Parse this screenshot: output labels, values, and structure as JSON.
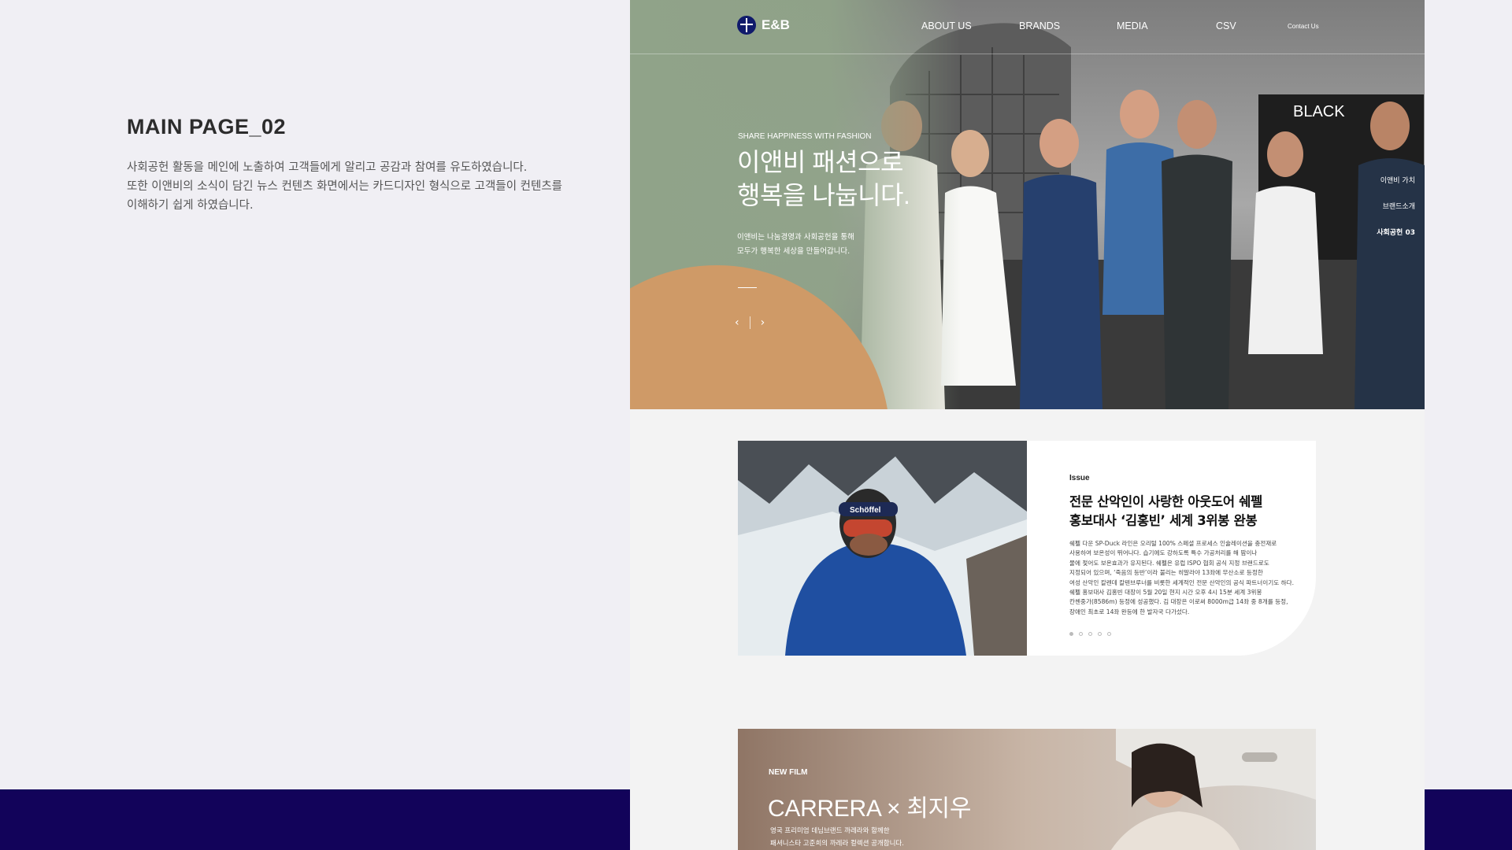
{
  "description": {
    "title": "MAIN PAGE_02",
    "lines": [
      "사회공헌 활동을 메인에 노출하여 고객들에게 알리고 공감과 참여를 유도하였습니다.",
      "또한 이앤비의 소식이 담긴 뉴스 컨텐츠 화면에서는 카드디자인 형식으로 고객들이 컨텐츠를",
      "이해하기 쉽게 하였습니다."
    ]
  },
  "site": {
    "logo": "E&B",
    "nav": [
      "ABOUT US",
      "BRANDS",
      "MEDIA",
      "CSV"
    ],
    "contact": "Contact Us",
    "hero": {
      "kicker": "SHARE HAPPINESS WITH FASHION",
      "title_lines": [
        "이앤비 패션으로",
        "행복을 나눕니다."
      ],
      "sub_lines": [
        "이앤비는 나눔경영과 사회공헌을 통해",
        "모두가 행복한 세상을 만들어갑니다."
      ],
      "prev": "‹",
      "next": "›",
      "photo_sign": "BLACK",
      "side_nav": [
        "이앤비 가치",
        "브랜드소개",
        "사회공헌 03"
      ]
    },
    "issue": {
      "tag": "Issue",
      "title_lines": [
        "전문 산악인이 사랑한 아웃도어 쉐펠",
        "홍보대사 ‘김홍빈’ 세계 3위봉 완봉"
      ],
      "body_lines": [
        "쉐펠 다운 SP-Duck 라인은 오리털 100% 스페셜 프로세스 인슐레이션을 충전재로",
        "사용하여 보온성이 뛰어나다. 습기에도 강하도록 특수 가공처리를 해 땀이나",
        "물에 젖어도 보온효과가 유지된다. 쉐펠은 유럽 ISPO 협회 공식 지정 브랜드로도",
        "지정되어 있으며, ‘죽음의 등반’이라 불리는 히말라야 13좌에 무산소로 등정한",
        "여성 산악인 칼렌데 칼텐브루너를 비롯한 세계적인 전문 산악인의 공식 파트너이기도 하다.",
        "쉐펠 홍보대사 김홍빈 대장이 5월 20일 현지 시간 오후 4시 15분 세계 3위봉",
        "칸첸중가(8586m) 등정에 성공했다. 김 대장은 이로써 8000m급 14좌 중 8개를 등정,",
        "장애인 최초로 14좌 완등에 한 발자국 다가섰다."
      ],
      "goggle_text": "Schöffel"
    },
    "film": {
      "kicker": "NEW FILM",
      "title": "CARRERA × 최지우",
      "sub_lines": [
        "영국 프리미엄 데님브랜드 까레라와 함께한",
        "패셔니스타 고준희의 까레라 컬렉션 공개합니다."
      ]
    }
  },
  "colors": {
    "band": "#12035a",
    "hero_green": "#90a389",
    "hero_orange": "#cf9a67",
    "logo_navy": "#101a6b"
  }
}
